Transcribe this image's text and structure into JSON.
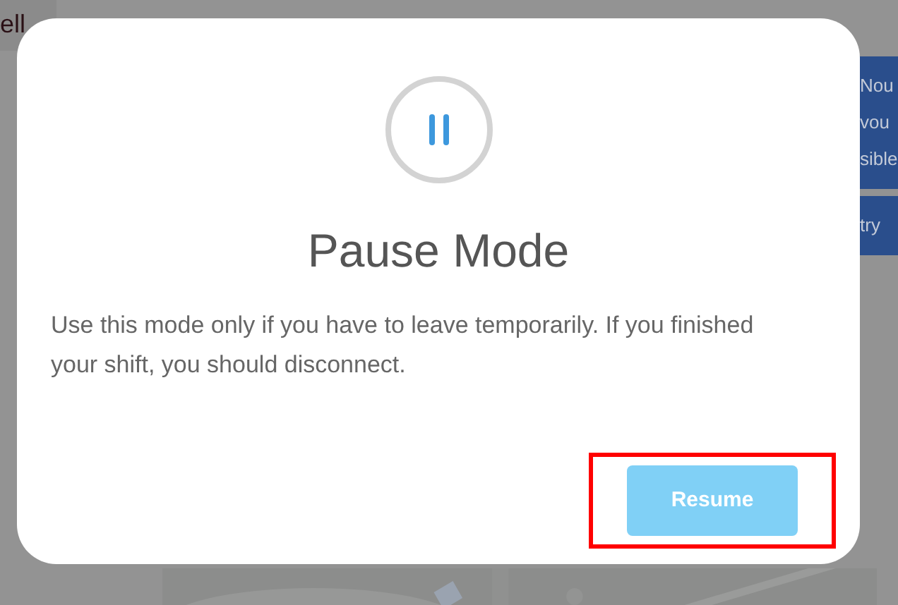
{
  "background": {
    "tab": "ell",
    "side_panel": {
      "lines": [
        "Nou",
        "vou",
        "sible"
      ],
      "button": "try"
    }
  },
  "dialog": {
    "title": "Pause Mode",
    "message": "Use this mode only if you have to leave temporarily. If you finished your shift, you should disconnect.",
    "button": {
      "label": "Resume",
      "highlighted": true
    }
  }
}
